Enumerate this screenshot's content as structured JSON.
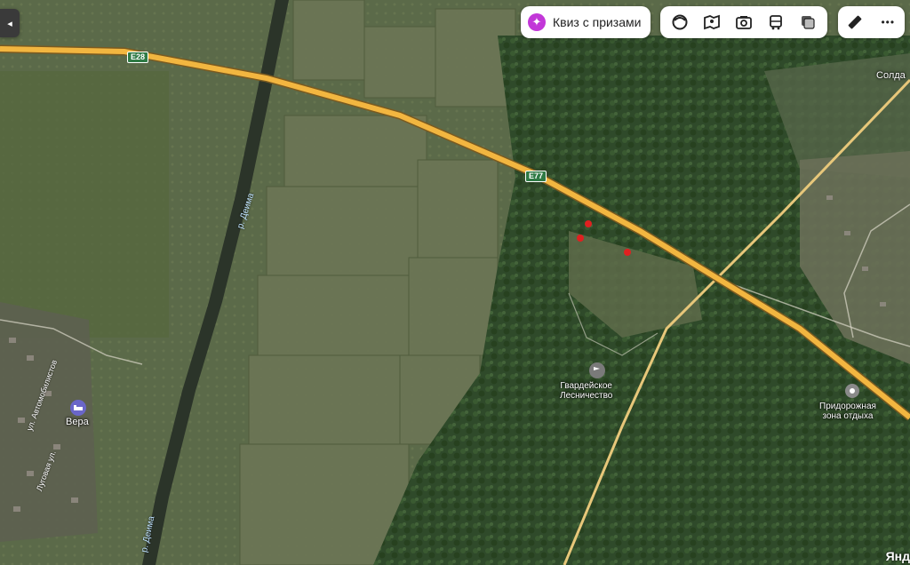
{
  "toolbar": {
    "quiz_label": "Квиз с призами",
    "collapse_glyph": "◂",
    "more_glyph": "•••"
  },
  "map": {
    "roads": [
      {
        "shield": "E28"
      },
      {
        "shield": "E77"
      }
    ],
    "places": {
      "soldatovo": "Солда",
      "vera": "Вера",
      "forestry_line1": "Гвардейское",
      "forestry_line2": "Лесничество",
      "rest_line1": "Придорожная",
      "rest_line2": "зона отдыха",
      "river_upper": "р. Деима",
      "river_lower": "р. Деима",
      "street1": "ул. Автомобилистов",
      "street2": "Луговая ул."
    },
    "watermark": "Янд"
  },
  "colors": {
    "highway": "#f2b640",
    "river": "#2b3429",
    "quiz_accent": "#c237d8"
  }
}
